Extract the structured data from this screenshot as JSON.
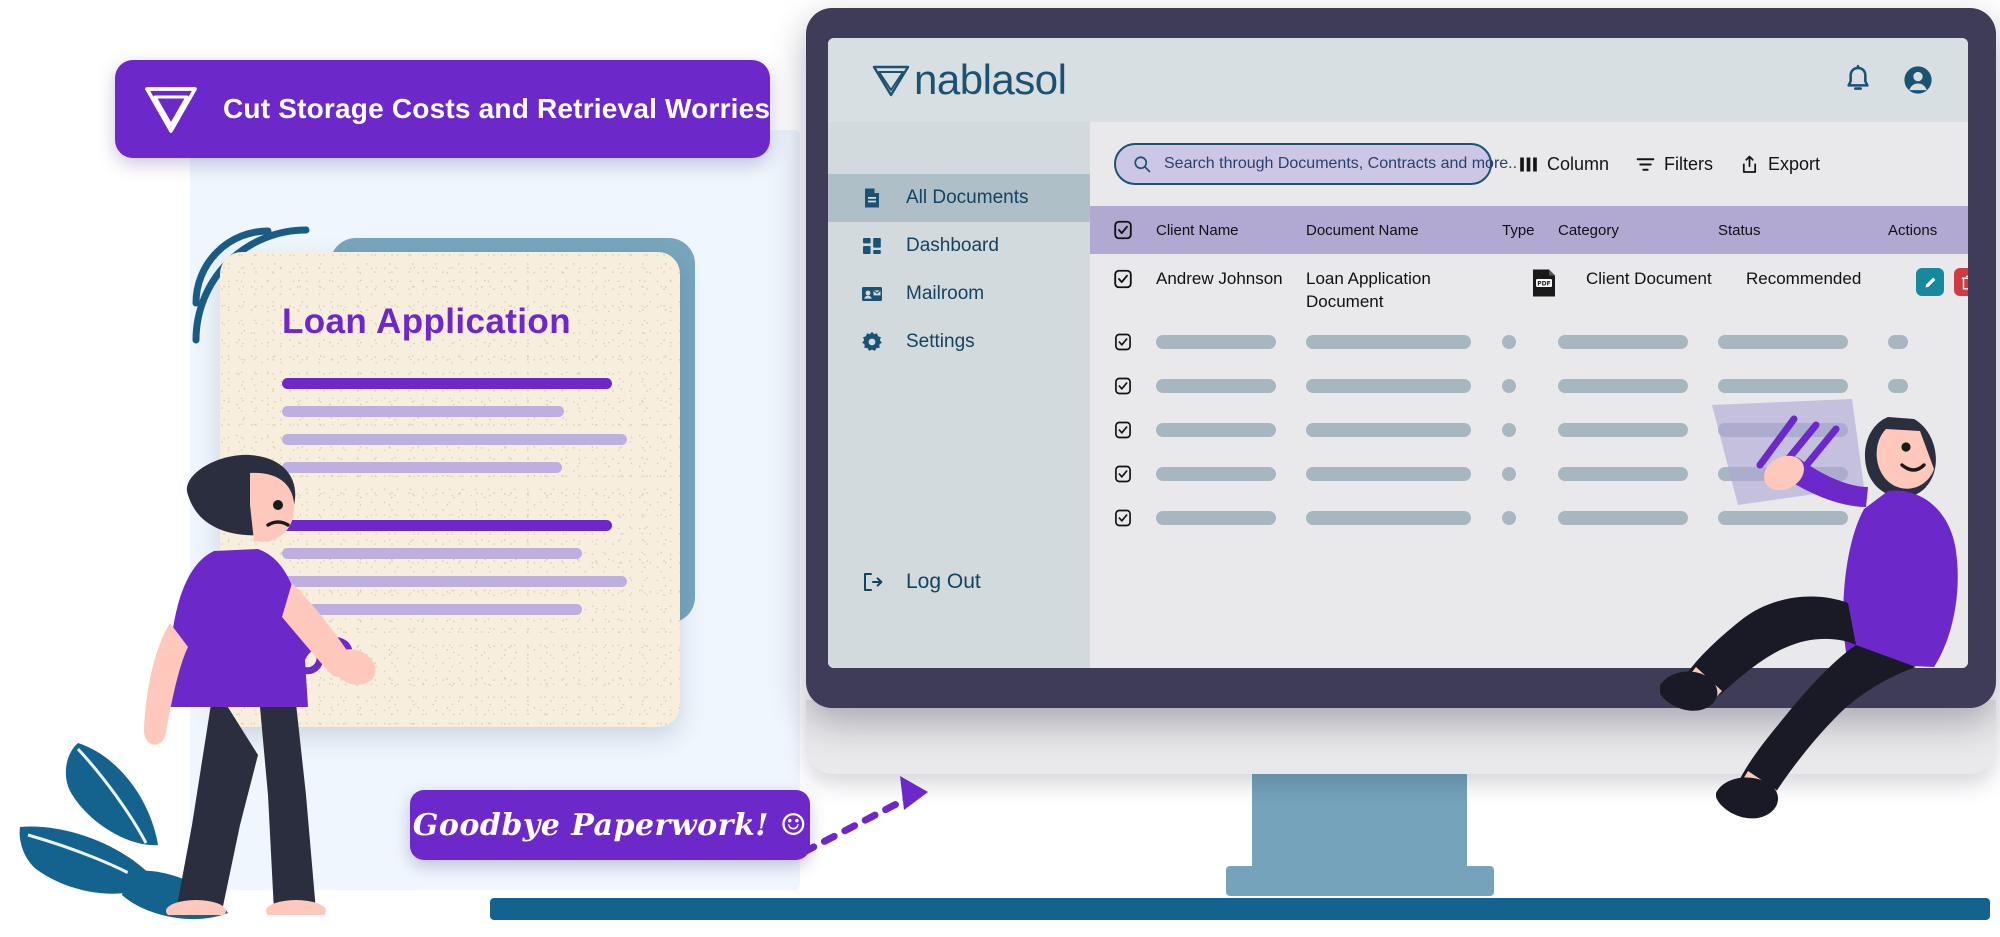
{
  "banner": {
    "text": "Cut Storage Costs and Retrieval Worries",
    "logo_icon": "nablasol-triangle-logo",
    "bg_color": "#6d28c9"
  },
  "paper": {
    "title": "Loan Application",
    "signature_icon": "signature-squiggle"
  },
  "chip": {
    "text": "Goodbye Paperwork! ☺",
    "bg_color": "#6d28c9"
  },
  "app": {
    "header": {
      "brand_name": "nablasol",
      "brand_mark_icon": "nabla-triangle-icon",
      "notification_icon": "bell-icon",
      "account_icon": "user-avatar-icon"
    },
    "sidebar": {
      "items": [
        {
          "label": "All Documents",
          "icon": "document-icon",
          "active": true
        },
        {
          "label": "Dashboard",
          "icon": "dashboard-grid-icon",
          "active": false
        },
        {
          "label": "Mailroom",
          "icon": "mailroom-contact-card-icon",
          "active": false
        },
        {
          "label": "Settings",
          "icon": "gear-icon",
          "active": false
        }
      ],
      "logout": {
        "label": "Log Out",
        "icon": "logout-icon"
      }
    },
    "toolbar": {
      "search_placeholder": "Search through Documents, Contracts and more..",
      "search_value": "",
      "search_icon": "search-icon",
      "buttons": [
        {
          "label": "Column",
          "icon": "column-icon"
        },
        {
          "label": "Filters",
          "icon": "filter-icon"
        },
        {
          "label": "Export",
          "icon": "export-upload-icon"
        }
      ]
    },
    "table": {
      "header_bg": "#b2a9d3",
      "select_all_icon": "checkbox-checked-icon",
      "columns": [
        "Client Name",
        "Document Name",
        "Type",
        "Category",
        "Status",
        "Actions"
      ],
      "rows": [
        {
          "selected": true,
          "client_name": "Andrew Johnson",
          "document_name": "Loan Application Document",
          "type_icon": "pdf-file-icon",
          "category": "Client Document",
          "status": "Recommended",
          "actions": [
            {
              "icon": "edit-pencil-icon",
              "color": "#17899c"
            },
            {
              "icon": "delete-trash-icon",
              "color": "#cf3b41"
            }
          ]
        }
      ],
      "skeleton_row_count": 5,
      "skeleton_checkbox_icon": "checkbox-checked-icon"
    }
  },
  "illustration": {
    "left_character": "man-standing-with-paper",
    "right_character": "man-sitting-on-monitor",
    "leaves": "teal-leaves-decoration",
    "arrow": "dashed-pointer-arrow",
    "arcs": "signal-arcs"
  }
}
